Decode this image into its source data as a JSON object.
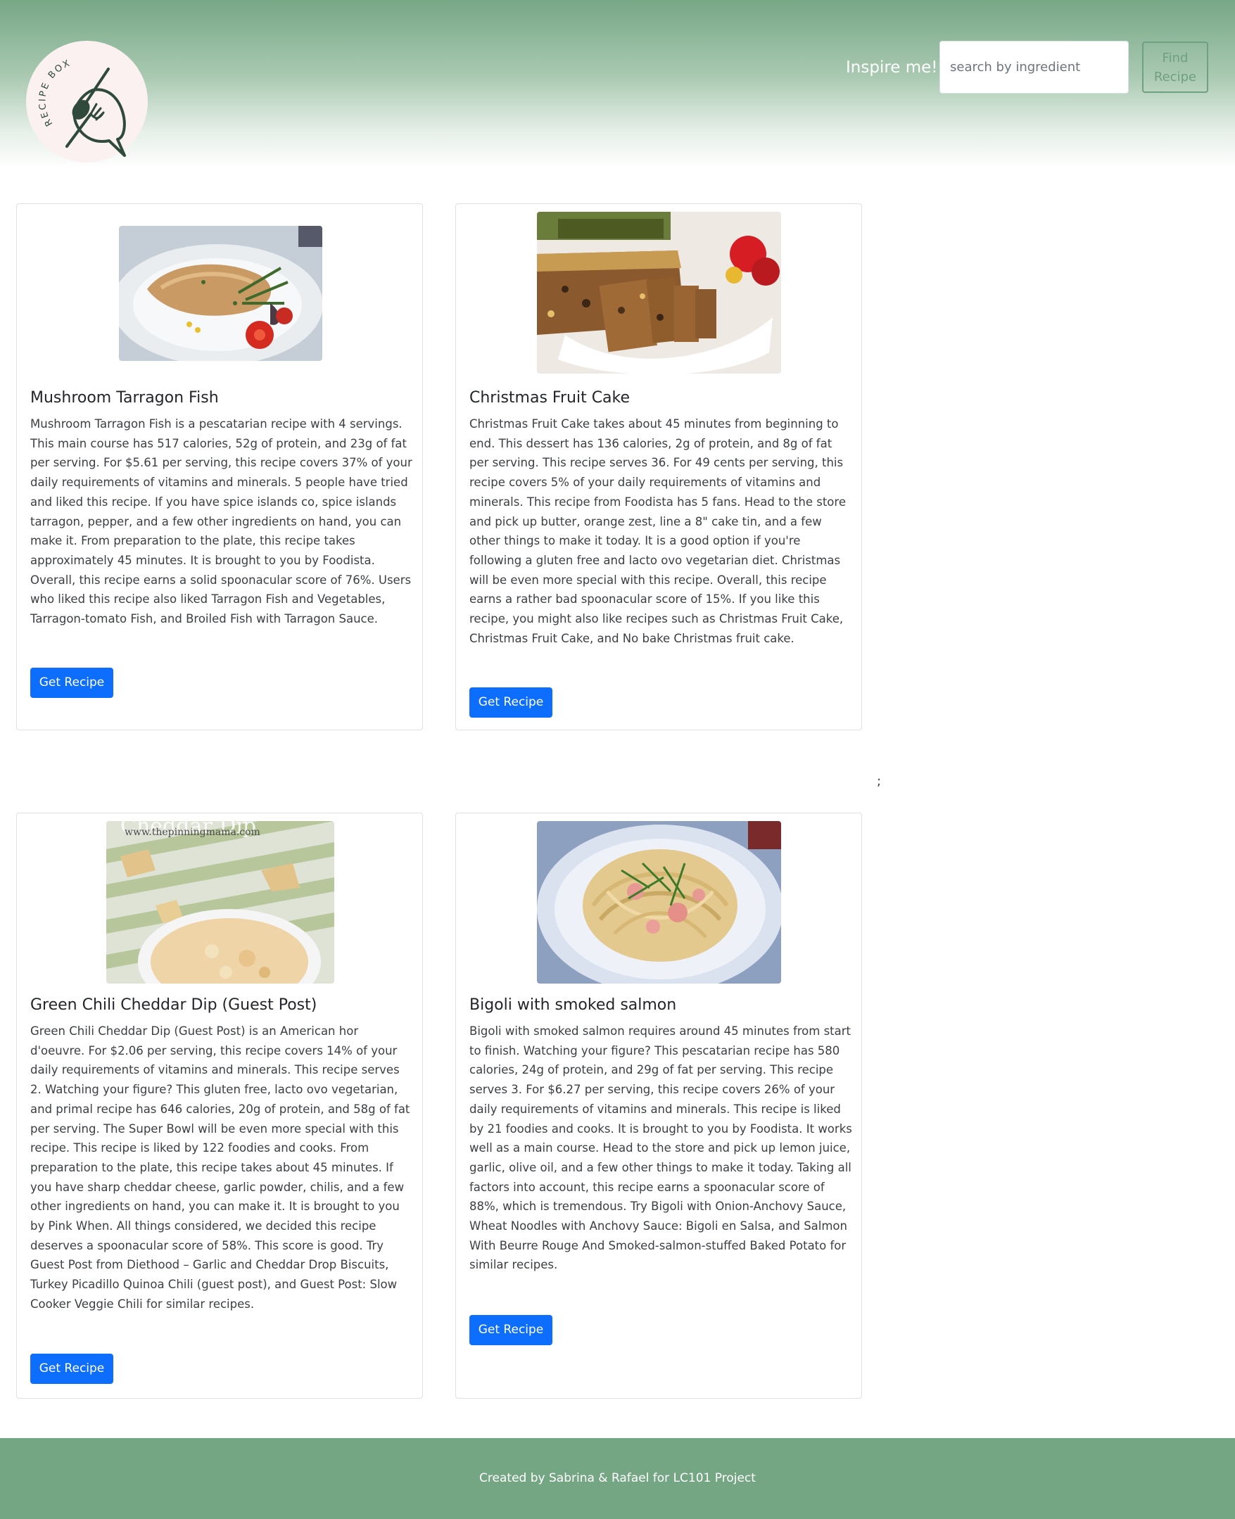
{
  "header": {
    "logo_text": "RECIPE BOX",
    "inspire_label": "Inspire me!",
    "search": {
      "placeholder": "search by ingredient",
      "value": ""
    },
    "find_label": "Find Recipe"
  },
  "recipes": [
    {
      "title": "Mushroom Tarragon Fish",
      "description": "Mushroom Tarragon Fish is a pescatarian recipe with 4 servings. This main course has 517 calories, 52g of protein, and 23g of fat per serving. For $5.61 per serving, this recipe covers 37% of your daily requirements of vitamins and minerals. 5 people have tried and liked this recipe. If you have spice islands co, spice islands tarragon, pepper, and a few other ingredients on hand, you can make it. From preparation to the plate, this recipe takes approximately 45 minutes. It is brought to you by Foodista. Overall, this recipe earns a solid spoonacular score of 76%. Users who liked this recipe also liked Tarragon Fish and Vegetables, Tarragon-tomato Fish, and Broiled Fish with Tarragon Sauce.",
      "button_label": "Get Recipe"
    },
    {
      "title": "Christmas Fruit Cake",
      "description": "Christmas Fruit Cake takes about 45 minutes from beginning to end. This dessert has 136 calories, 2g of protein, and 8g of fat per serving. This recipe serves 36. For 49 cents per serving, this recipe covers 5% of your daily requirements of vitamins and minerals. This recipe from Foodista has 5 fans. Head to the store and pick up butter, orange zest, line a 8\" cake tin, and a few other things to make it today. It is a good option if you're following a gluten free and lacto ovo vegetarian diet. Christmas will be even more special with this recipe. Overall, this recipe earns a rather bad spoonacular score of 15%. If you like this recipe, you might also like recipes such as Christmas Fruit Cake, Christmas Fruit Cake, and No bake Christmas fruit cake.",
      "button_label": "Get Recipe"
    },
    {
      "title": "Green Chili Cheddar Dip (Guest Post)",
      "description": "Green Chili Cheddar Dip (Guest Post) is an American hor d'oeuvre. For $2.06 per serving, this recipe covers 14% of your daily requirements of vitamins and minerals. This recipe serves 2. Watching your figure? This gluten free, lacto ovo vegetarian, and primal recipe has 646 calories, 20g of protein, and 58g of fat per serving. The Super Bowl will be even more special with this recipe. This recipe is liked by 122 foodies and cooks. From preparation to the plate, this recipe takes about 45 minutes. If you have sharp cheddar cheese, garlic powder, chilis, and a few other ingredients on hand, you can make it. It is brought to you by Pink When. All things considered, we decided this recipe deserves a spoonacular score of 58%. This score is good. Try Guest Post from Diethood – Garlic and Cheddar Drop Biscuits, Turkey Picadillo Quinoa Chili (guest post), and Guest Post: Slow Cooker Veggie Chili for similar recipes.",
      "button_label": "Get Recipe",
      "image_caption_1": "Cheddar Dip",
      "image_caption_2": "www.thepinningmama.com"
    },
    {
      "title": "Bigoli with smoked salmon",
      "description": "Bigoli with smoked salmon requires around 45 minutes from start to finish. Watching your figure? This pescatarian recipe has 580 calories, 24g of protein, and 29g of fat per serving. This recipe serves 3. For $6.27 per serving, this recipe covers 26% of your daily requirements of vitamins and minerals. This recipe is liked by 21 foodies and cooks. It is brought to you by Foodista. It works well as a main course. Head to the store and pick up lemon juice, garlic, olive oil, and a few other things to make it today. Taking all factors into account, this recipe earns a spoonacular score of 88%, which is tremendous. Try Bigoli with Onion-Anchovy Sauce, Wheat Noodles with Anchovy Sauce: Bigoli en Salsa, and Salmon With Beurre Rouge And Smoked-salmon-stuffed Baked Potato for similar recipes.",
      "button_label": "Get Recipe"
    }
  ],
  "stray_text": ";",
  "footer": {
    "text": "Created by Sabrina & Rafael for LC101 Project"
  },
  "colors": {
    "header_green": "#77a786",
    "footer_green": "#74a683",
    "button_blue": "#0d6efd",
    "logo_bg": "#fbf1f1",
    "logo_ink": "#2f4a3a"
  }
}
